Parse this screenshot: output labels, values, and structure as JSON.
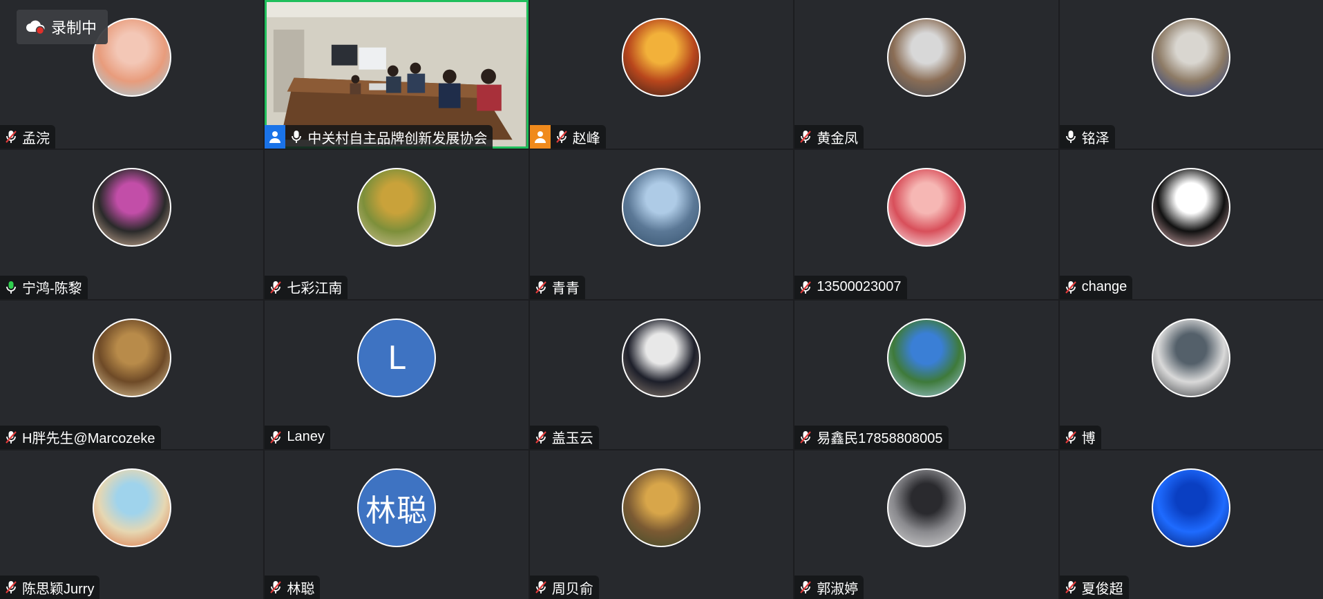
{
  "recording": {
    "label": "录制中",
    "icon": "cloud-recording-icon"
  },
  "participants": [
    {
      "name": "孟浣",
      "mic": "muted",
      "avatar": "photo",
      "colors": [
        "#f3c7b6",
        "#e89c7c",
        "#9ad2e8"
      ]
    },
    {
      "name": "中关村自主品牌创新发展协会",
      "mic": "active-white",
      "avatar": "video",
      "host": "blue",
      "active": true
    },
    {
      "name": "赵峰",
      "mic": "muted",
      "avatar": "photo",
      "host": "orange",
      "colors": [
        "#f2b13a",
        "#b8461c",
        "#2d1f1a"
      ]
    },
    {
      "name": "黄金凤",
      "mic": "muted",
      "avatar": "photo",
      "colors": [
        "#d8d8d8",
        "#8a6d55",
        "#3d4a5a"
      ]
    },
    {
      "name": "铭泽",
      "mic": "active-white",
      "avatar": "photo",
      "colors": [
        "#d9d6d0",
        "#8d7b66",
        "#1e3a8a"
      ]
    },
    {
      "name": "宁鸿-陈黎",
      "mic": "active-green",
      "avatar": "photo",
      "colors": [
        "#c24ea8",
        "#2a2a2a",
        "#e6c2a6"
      ]
    },
    {
      "name": "七彩江南",
      "mic": "muted",
      "avatar": "photo",
      "colors": [
        "#c9a23a",
        "#7d8f3a",
        "#d8c8a0"
      ]
    },
    {
      "name": "青青",
      "mic": "muted",
      "avatar": "photo",
      "colors": [
        "#aecbe6",
        "#5b7896",
        "#34506b"
      ]
    },
    {
      "name": "13500023007",
      "mic": "muted",
      "avatar": "photo",
      "colors": [
        "#f6b7b4",
        "#d84f5a",
        "#ffffff"
      ]
    },
    {
      "name": "change",
      "mic": "muted",
      "avatar": "photo",
      "colors": [
        "#ffffff",
        "#111111",
        "#f7c6c8"
      ]
    },
    {
      "name": "H胖先生@Marcozeke",
      "mic": "muted",
      "avatar": "photo",
      "colors": [
        "#b88b4a",
        "#6e4a27",
        "#e8d3a6"
      ]
    },
    {
      "name": "Laney",
      "mic": "muted",
      "avatar": "initial",
      "initial": "L"
    },
    {
      "name": "盖玉云",
      "mic": "muted",
      "avatar": "photo",
      "colors": [
        "#e8e8e8",
        "#1d1f2a",
        "#9a8a7a"
      ]
    },
    {
      "name": "易鑫民17858808005",
      "mic": "muted",
      "avatar": "photo",
      "colors": [
        "#3a7fd6",
        "#3e7a3a",
        "#a9cdea"
      ]
    },
    {
      "name": "博",
      "mic": "muted",
      "avatar": "photo",
      "colors": [
        "#54606a",
        "#d9d9d9",
        "#2a2d31"
      ]
    },
    {
      "name": "陈思颖Jurry",
      "mic": "muted",
      "avatar": "photo",
      "colors": [
        "#9fd3ec",
        "#e6d7b2",
        "#d96a3b"
      ]
    },
    {
      "name": "林聪",
      "mic": "muted",
      "avatar": "initial",
      "initial": "林聪"
    },
    {
      "name": "周贝俞",
      "mic": "muted",
      "avatar": "photo",
      "colors": [
        "#d8a64a",
        "#7b5a33",
        "#3a4b2a"
      ]
    },
    {
      "name": "郭淑婷",
      "mic": "muted",
      "avatar": "photo",
      "colors": [
        "#2a2a2e",
        "#8a8a8e",
        "#d9d9d9"
      ]
    },
    {
      "name": "夏俊超",
      "mic": "muted",
      "avatar": "photo",
      "colors": [
        "#0a3fc2",
        "#1e6bff",
        "#021a6b"
      ]
    }
  ]
}
